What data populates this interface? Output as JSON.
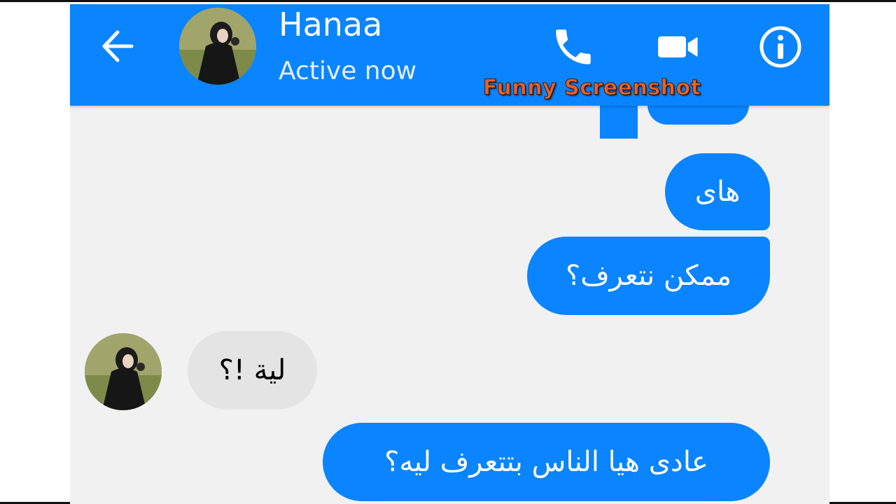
{
  "header": {
    "contact_name": "Hanaa",
    "status": "Active now",
    "back_icon": "arrow-left-icon",
    "call_icon": "phone-icon",
    "video_icon": "video-camera-icon",
    "info_icon": "info-icon"
  },
  "watermark": "Funny Screenshot",
  "messages": [
    {
      "direction": "outgoing",
      "text": "هاى"
    },
    {
      "direction": "outgoing",
      "text": "ممكن نتعرف؟"
    },
    {
      "direction": "incoming",
      "text": "لية !؟"
    },
    {
      "direction": "outgoing",
      "text": "عادى هيا الناس بتتعرف ليه؟"
    }
  ],
  "colors": {
    "accent": "#0a84ff",
    "incoming_bubble": "#e4e4e4",
    "background": "#f1f1f1",
    "watermark": "#e8622a"
  }
}
